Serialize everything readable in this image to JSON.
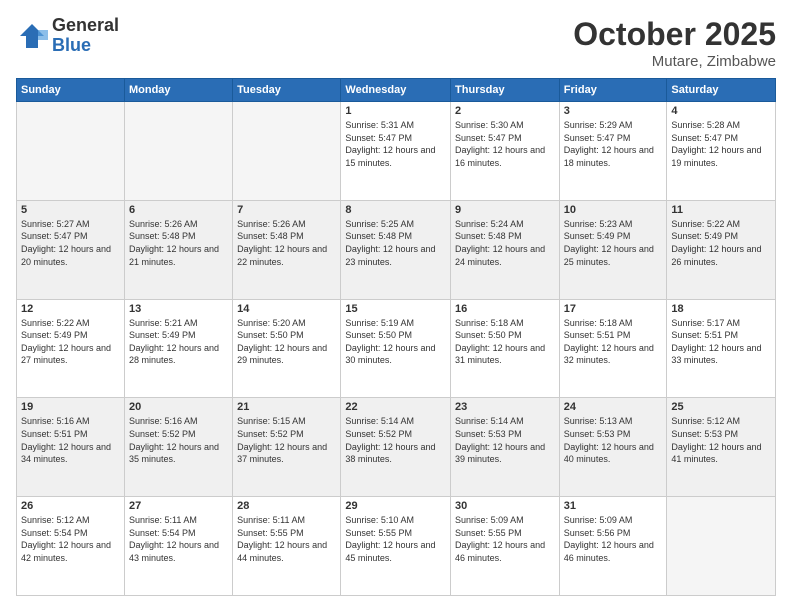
{
  "logo": {
    "general": "General",
    "blue": "Blue"
  },
  "title": "October 2025",
  "location": "Mutare, Zimbabwe",
  "days_of_week": [
    "Sunday",
    "Monday",
    "Tuesday",
    "Wednesday",
    "Thursday",
    "Friday",
    "Saturday"
  ],
  "weeks": [
    [
      {
        "day": "",
        "info": ""
      },
      {
        "day": "",
        "info": ""
      },
      {
        "day": "",
        "info": ""
      },
      {
        "day": "1",
        "info": "Sunrise: 5:31 AM\nSunset: 5:47 PM\nDaylight: 12 hours\nand 15 minutes."
      },
      {
        "day": "2",
        "info": "Sunrise: 5:30 AM\nSunset: 5:47 PM\nDaylight: 12 hours\nand 16 minutes."
      },
      {
        "day": "3",
        "info": "Sunrise: 5:29 AM\nSunset: 5:47 PM\nDaylight: 12 hours\nand 18 minutes."
      },
      {
        "day": "4",
        "info": "Sunrise: 5:28 AM\nSunset: 5:47 PM\nDaylight: 12 hours\nand 19 minutes."
      }
    ],
    [
      {
        "day": "5",
        "info": "Sunrise: 5:27 AM\nSunset: 5:47 PM\nDaylight: 12 hours\nand 20 minutes."
      },
      {
        "day": "6",
        "info": "Sunrise: 5:26 AM\nSunset: 5:48 PM\nDaylight: 12 hours\nand 21 minutes."
      },
      {
        "day": "7",
        "info": "Sunrise: 5:26 AM\nSunset: 5:48 PM\nDaylight: 12 hours\nand 22 minutes."
      },
      {
        "day": "8",
        "info": "Sunrise: 5:25 AM\nSunset: 5:48 PM\nDaylight: 12 hours\nand 23 minutes."
      },
      {
        "day": "9",
        "info": "Sunrise: 5:24 AM\nSunset: 5:48 PM\nDaylight: 12 hours\nand 24 minutes."
      },
      {
        "day": "10",
        "info": "Sunrise: 5:23 AM\nSunset: 5:49 PM\nDaylight: 12 hours\nand 25 minutes."
      },
      {
        "day": "11",
        "info": "Sunrise: 5:22 AM\nSunset: 5:49 PM\nDaylight: 12 hours\nand 26 minutes."
      }
    ],
    [
      {
        "day": "12",
        "info": "Sunrise: 5:22 AM\nSunset: 5:49 PM\nDaylight: 12 hours\nand 27 minutes."
      },
      {
        "day": "13",
        "info": "Sunrise: 5:21 AM\nSunset: 5:49 PM\nDaylight: 12 hours\nand 28 minutes."
      },
      {
        "day": "14",
        "info": "Sunrise: 5:20 AM\nSunset: 5:50 PM\nDaylight: 12 hours\nand 29 minutes."
      },
      {
        "day": "15",
        "info": "Sunrise: 5:19 AM\nSunset: 5:50 PM\nDaylight: 12 hours\nand 30 minutes."
      },
      {
        "day": "16",
        "info": "Sunrise: 5:18 AM\nSunset: 5:50 PM\nDaylight: 12 hours\nand 31 minutes."
      },
      {
        "day": "17",
        "info": "Sunrise: 5:18 AM\nSunset: 5:51 PM\nDaylight: 12 hours\nand 32 minutes."
      },
      {
        "day": "18",
        "info": "Sunrise: 5:17 AM\nSunset: 5:51 PM\nDaylight: 12 hours\nand 33 minutes."
      }
    ],
    [
      {
        "day": "19",
        "info": "Sunrise: 5:16 AM\nSunset: 5:51 PM\nDaylight: 12 hours\nand 34 minutes."
      },
      {
        "day": "20",
        "info": "Sunrise: 5:16 AM\nSunset: 5:52 PM\nDaylight: 12 hours\nand 35 minutes."
      },
      {
        "day": "21",
        "info": "Sunrise: 5:15 AM\nSunset: 5:52 PM\nDaylight: 12 hours\nand 37 minutes."
      },
      {
        "day": "22",
        "info": "Sunrise: 5:14 AM\nSunset: 5:52 PM\nDaylight: 12 hours\nand 38 minutes."
      },
      {
        "day": "23",
        "info": "Sunrise: 5:14 AM\nSunset: 5:53 PM\nDaylight: 12 hours\nand 39 minutes."
      },
      {
        "day": "24",
        "info": "Sunrise: 5:13 AM\nSunset: 5:53 PM\nDaylight: 12 hours\nand 40 minutes."
      },
      {
        "day": "25",
        "info": "Sunrise: 5:12 AM\nSunset: 5:53 PM\nDaylight: 12 hours\nand 41 minutes."
      }
    ],
    [
      {
        "day": "26",
        "info": "Sunrise: 5:12 AM\nSunset: 5:54 PM\nDaylight: 12 hours\nand 42 minutes."
      },
      {
        "day": "27",
        "info": "Sunrise: 5:11 AM\nSunset: 5:54 PM\nDaylight: 12 hours\nand 43 minutes."
      },
      {
        "day": "28",
        "info": "Sunrise: 5:11 AM\nSunset: 5:55 PM\nDaylight: 12 hours\nand 44 minutes."
      },
      {
        "day": "29",
        "info": "Sunrise: 5:10 AM\nSunset: 5:55 PM\nDaylight: 12 hours\nand 45 minutes."
      },
      {
        "day": "30",
        "info": "Sunrise: 5:09 AM\nSunset: 5:55 PM\nDaylight: 12 hours\nand 46 minutes."
      },
      {
        "day": "31",
        "info": "Sunrise: 5:09 AM\nSunset: 5:56 PM\nDaylight: 12 hours\nand 46 minutes."
      },
      {
        "day": "",
        "info": ""
      }
    ]
  ]
}
